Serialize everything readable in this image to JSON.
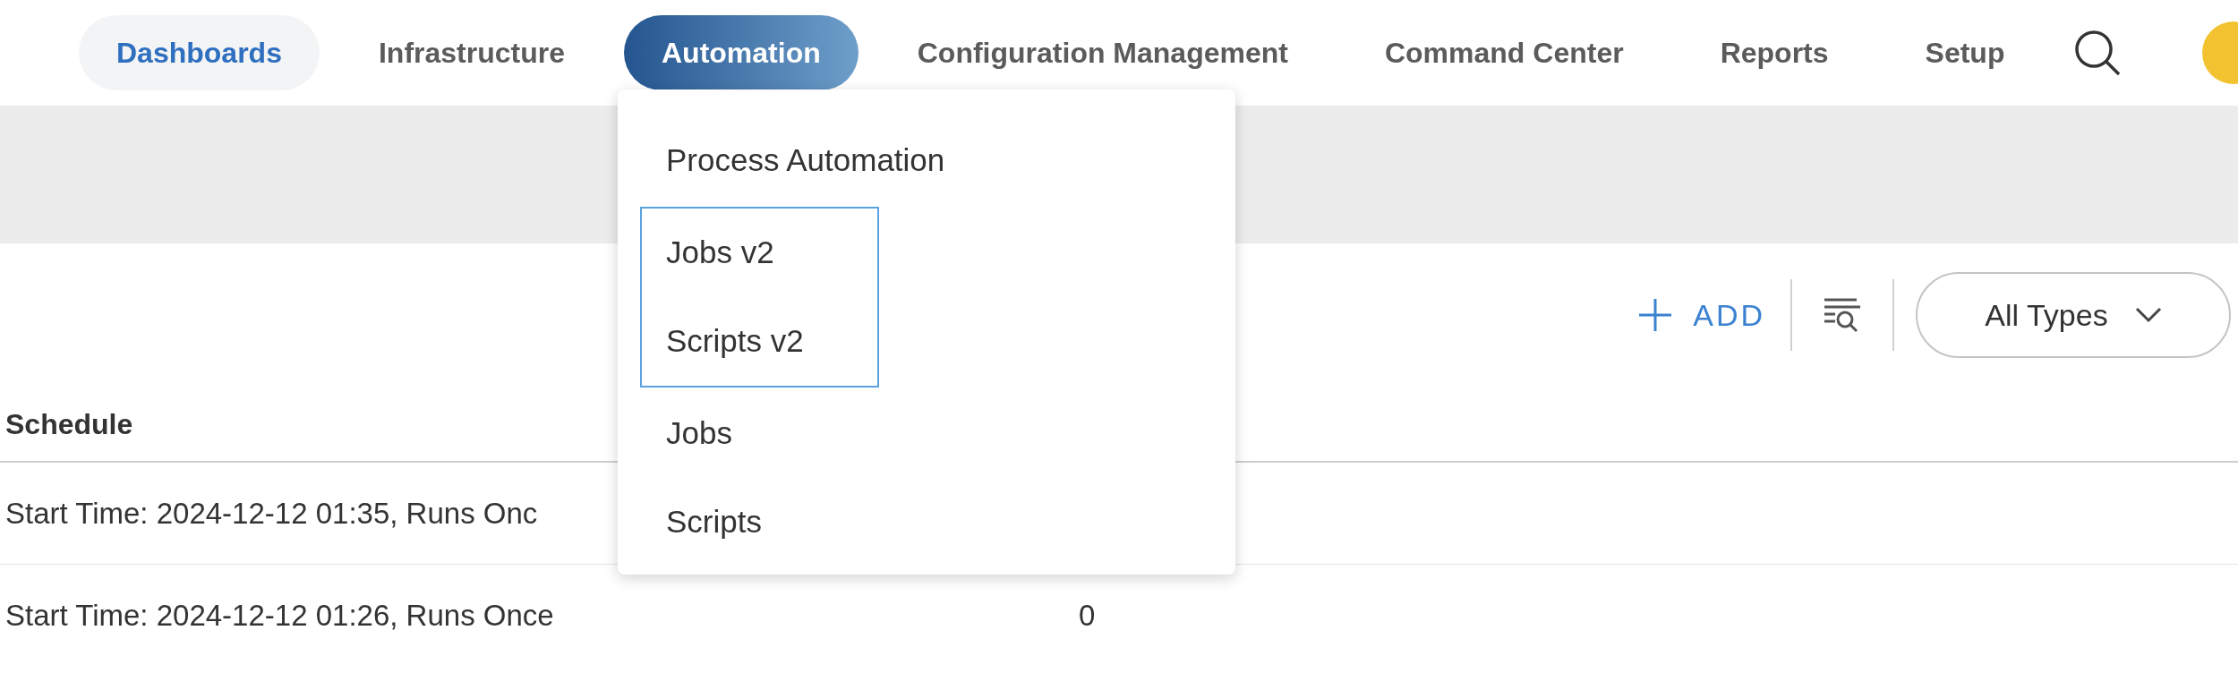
{
  "nav": {
    "items": [
      {
        "label": "Dashboards",
        "current": true,
        "selected": false
      },
      {
        "label": "Infrastructure",
        "current": false,
        "selected": false
      },
      {
        "label": "Automation",
        "current": false,
        "selected": true
      },
      {
        "label": "Configuration Management",
        "current": false,
        "selected": false
      },
      {
        "label": "Command Center",
        "current": false,
        "selected": false
      },
      {
        "label": "Reports",
        "current": false,
        "selected": false
      },
      {
        "label": "Setup",
        "current": false,
        "selected": false
      }
    ]
  },
  "menu": {
    "sections": [
      {
        "focused": false,
        "items": [
          "Process Automation"
        ]
      },
      {
        "focused": true,
        "items": [
          "Jobs v2",
          "Scripts v2"
        ]
      },
      {
        "focused": false,
        "items": [
          "Jobs",
          "Scripts"
        ]
      }
    ]
  },
  "toolbar": {
    "add_label": "ADD",
    "type_filter": "All Types"
  },
  "table": {
    "columns": [
      "Schedule"
    ],
    "rows": [
      {
        "schedule": "Start Time: 2024-12-12 01:35, Runs Onc"
      },
      {
        "schedule": "Start Time: 2024-12-12 01:26, Runs Once",
        "column_2": "0"
      }
    ]
  }
}
